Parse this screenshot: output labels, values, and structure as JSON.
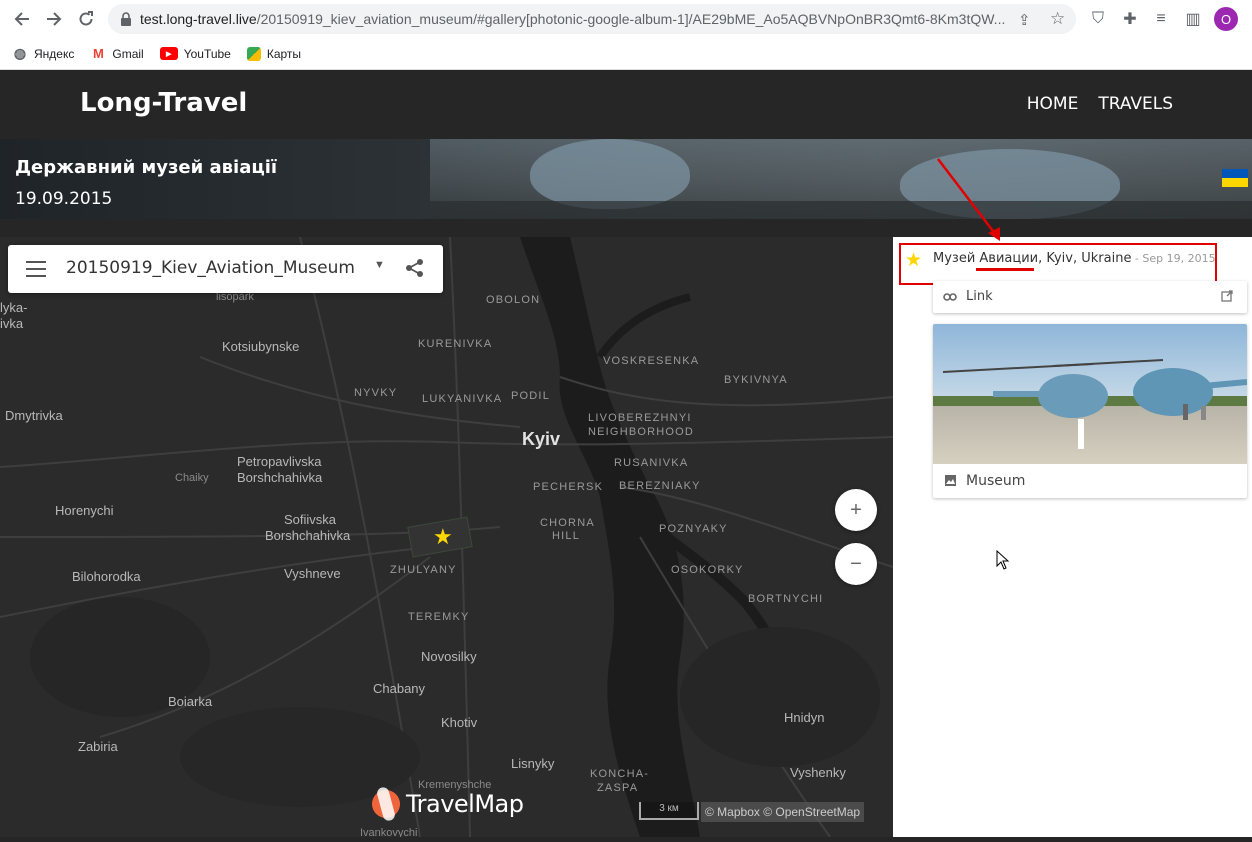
{
  "browser": {
    "url_host": "test.long-travel.live",
    "url_path": "/20150919_kiev_aviation_museum/#gallery[photonic-google-album-1]/AE29bME_Ao5AQBVNpOnBR3Qmt6-8Km3tQW...",
    "profile_initial": "O",
    "bookmarks": [
      {
        "label": "Яндекс",
        "icon": "globe-icon"
      },
      {
        "label": "Gmail",
        "icon": "gmail-icon"
      },
      {
        "label": "YouTube",
        "icon": "youtube-icon"
      },
      {
        "label": "Карты",
        "icon": "maps-icon"
      }
    ]
  },
  "site": {
    "logo": "Long-Travel",
    "nav": [
      "HOME",
      "TRAVELS"
    ]
  },
  "hero": {
    "title": "Державний музей авіації",
    "date": "19.09.2015",
    "flag": "ukraine-flag"
  },
  "map": {
    "album_title": "20150919_Kiev_Aviation_Museum",
    "zoom_in": "+",
    "zoom_out": "−",
    "logo_text": "TravelMap",
    "scale": "3 км",
    "attribution": "© Mapbox © OpenStreetMap",
    "labels": {
      "lisopark": "lisopark",
      "lyka": "lyka-",
      "ivka": "ivka",
      "kotsiubynske": "Kotsiubynske",
      "obolon": "OBOLON",
      "kurenivka": "KURENIVKA",
      "voskresenka": "VOSKRESENKA",
      "bykivnya": "BYKIVNYA",
      "nyvky": "NYVKY",
      "lukyanivka": "LUKYANIVKA",
      "podil": "PODIL",
      "dmytrivka": "Dmytrivka",
      "livoberezhnyi": "LIVOBEREZHNYI",
      "neighborhood": "NEIGHBORHOOD",
      "kyiv": "Kyiv",
      "petropavlivska": "Petropavlivska",
      "borshchahivka1": "Borshchahivka",
      "chaiky": "Chaiky",
      "rusanivka": "RUSANIVKA",
      "pechersk": "PECHERSK",
      "berezniaky": "BEREZNIAKY",
      "horenychi": "Horenychi",
      "sofiivska": "Sofiivska",
      "borshchahivka2": "Borshchahivka",
      "chorna": "CHORNA",
      "hill": "HILL",
      "poznyaky": "POZNYAKY",
      "zhulyany": "ZHULYANY",
      "osokorky": "OSOKORKY",
      "bilohorodka": "Bilohorodka",
      "vyshneve": "Vyshneve",
      "bortnychi": "BORTNYCHI",
      "teremky": "TEREMKY",
      "novosilky": "Novosilky",
      "chabany": "Chabany",
      "boiarka": "Boiarka",
      "khotiv": "Khotiv",
      "hnidyn": "Hnidyn",
      "zabiria": "Zabiria",
      "lisnyky": "Lisnyky",
      "koncha": "KONCHA-",
      "zaspa": "ZASPA",
      "vyshenky": "Vyshenky",
      "kremenyshche": "Kremenyshche",
      "ivankovychi": "Ivankovychi"
    }
  },
  "panel": {
    "place_name_part1": "Музей ",
    "place_name_part2": "Авиации",
    "place_name_part3": ", Kyiv, Ukraine",
    "place_date": " - Sep 19, 2015",
    "link_label": "Link",
    "photo_caption": "Museum"
  },
  "colors": {
    "header_bg": "#262626",
    "map_bg": "#2b2b2b",
    "annotation_red": "#e00000",
    "star_yellow": "#ffd600",
    "logo_orange": "#f0643c"
  }
}
